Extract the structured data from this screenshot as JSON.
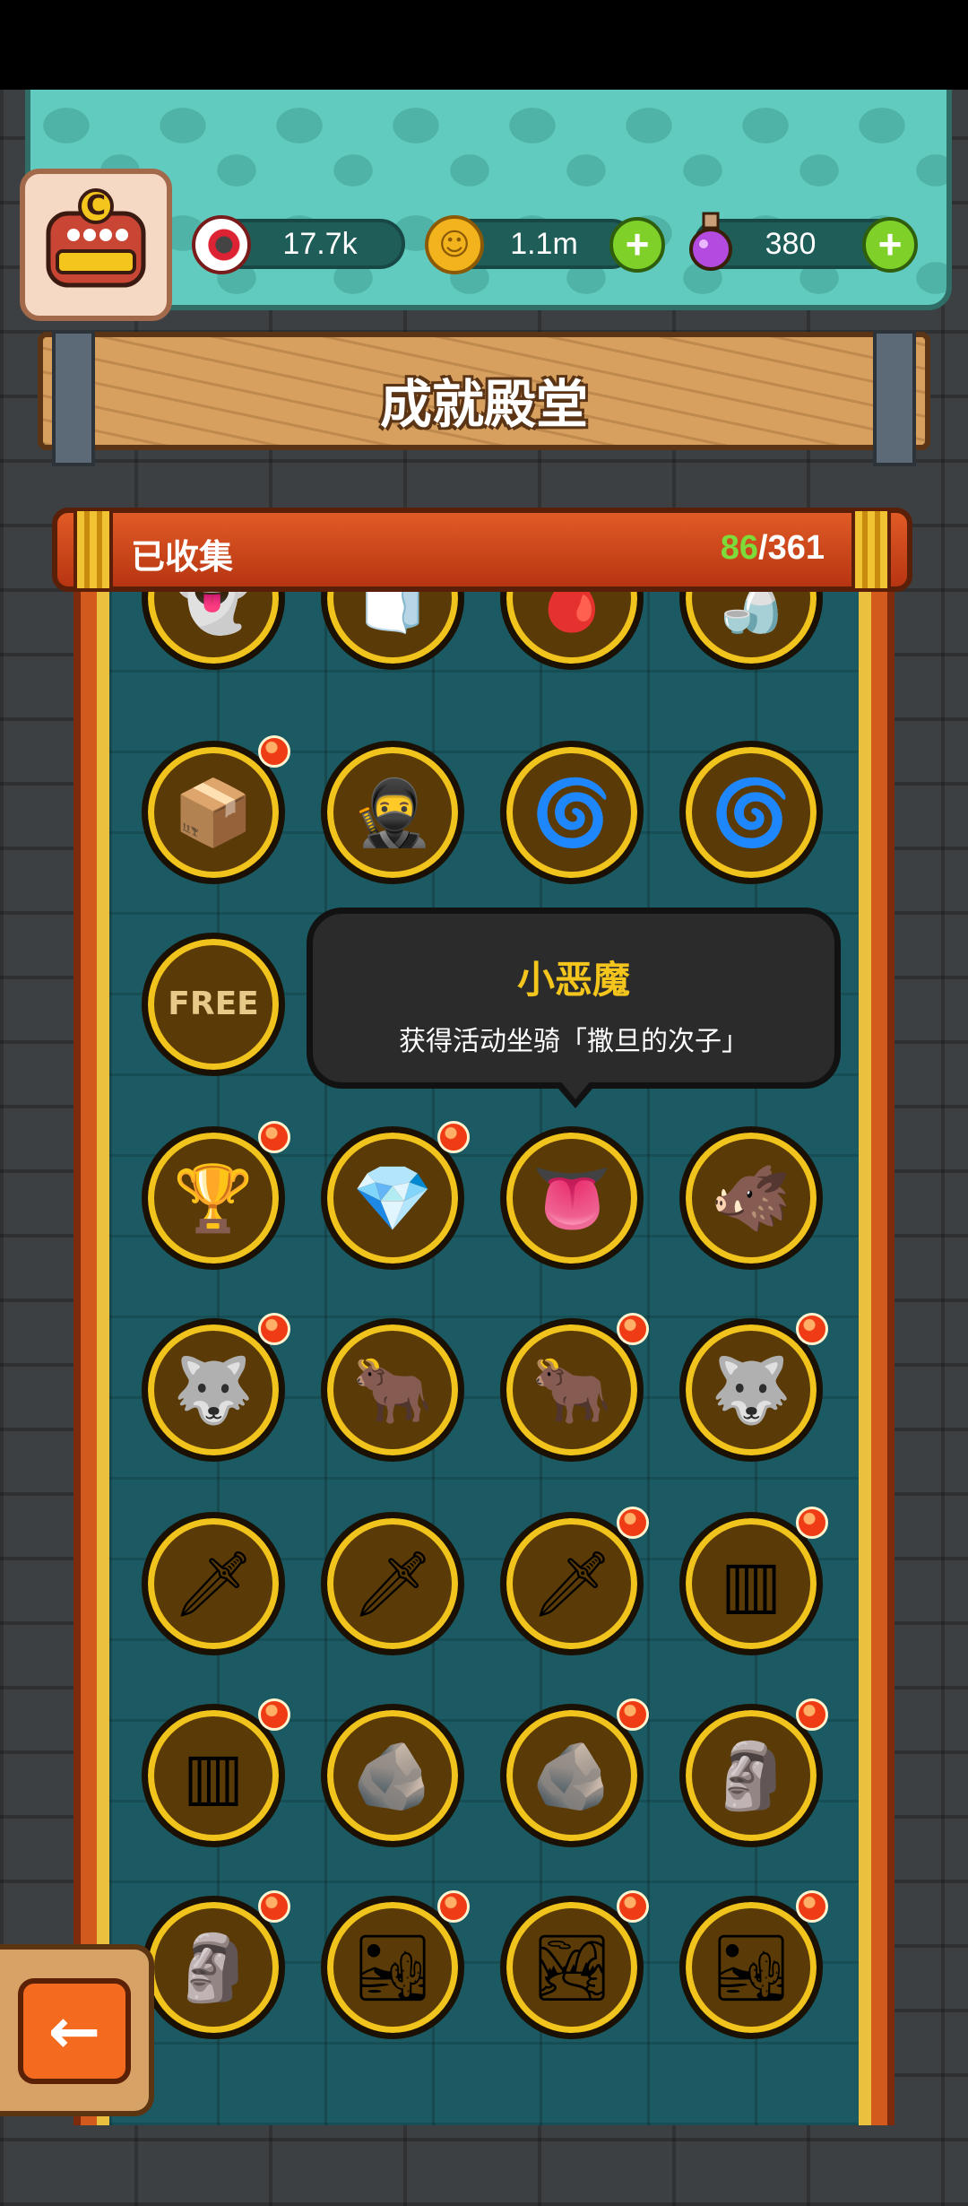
{
  "resources": {
    "eyes": {
      "value": "17.7k",
      "icon": "eyeball-icon"
    },
    "coins": {
      "value": "1.1m",
      "icon": "coin-icon"
    },
    "potions": {
      "value": "380",
      "icon": "potion-icon"
    },
    "avatar_letter": "C"
  },
  "header": {
    "title": "成就殿堂"
  },
  "collection": {
    "label": "已收集",
    "collected": "86",
    "total": "/361"
  },
  "tooltip": {
    "title": "小恶魔",
    "description": "获得活动坐骑「撒旦的次子」"
  },
  "back_button": {
    "icon": "arrow-left-icon",
    "glyph": "←"
  },
  "achievements": [
    {
      "name": "ghost-flower",
      "glyph": "👻",
      "new": false
    },
    {
      "name": "toilet-paper",
      "glyph": "🧻",
      "new": false
    },
    {
      "name": "blood-drop",
      "glyph": "🩸",
      "new": false
    },
    {
      "name": "sauce-bottle",
      "glyph": "🍶",
      "new": false
    },
    {
      "name": "blood-crate",
      "glyph": "📦",
      "new": true
    },
    {
      "name": "ninja",
      "glyph": "🥷",
      "new": false
    },
    {
      "name": "gold-oven",
      "glyph": "🌀",
      "new": false
    },
    {
      "name": "silver-oven",
      "glyph": "🌀",
      "new": false
    },
    {
      "name": "free-stand",
      "glyph": "FREE",
      "new": false
    },
    {
      "name": "silver-trophy",
      "glyph": "🏆",
      "new": true
    },
    {
      "name": "red-crystals",
      "glyph": "💎",
      "new": true
    },
    {
      "name": "little-demon",
      "glyph": "👅",
      "new": false
    },
    {
      "name": "bronze-boar",
      "glyph": "🐗",
      "new": false
    },
    {
      "name": "gold-beast",
      "glyph": "🐺",
      "new": true
    },
    {
      "name": "bronze-horned",
      "glyph": "🐂",
      "new": false
    },
    {
      "name": "gold-horned",
      "glyph": "🐂",
      "new": true
    },
    {
      "name": "silver-beast",
      "glyph": "🐺",
      "new": true
    },
    {
      "name": "bronze-sword",
      "glyph": "🗡",
      "new": false
    },
    {
      "name": "gold-sword",
      "glyph": "🗡",
      "new": false
    },
    {
      "name": "silver-sword",
      "glyph": "🗡",
      "new": true
    },
    {
      "name": "bronze-cage",
      "glyph": "▥",
      "new": true
    },
    {
      "name": "gold-cage",
      "glyph": "▥",
      "new": true
    },
    {
      "name": "bronze-pile",
      "glyph": "🪨",
      "new": false
    },
    {
      "name": "gold-pile",
      "glyph": "🪨",
      "new": true
    },
    {
      "name": "bronze-totem",
      "glyph": "🗿",
      "new": true
    },
    {
      "name": "gold-totem",
      "glyph": "🗿",
      "new": true
    },
    {
      "name": "bronze-landscape",
      "glyph": "🏜",
      "new": true
    },
    {
      "name": "silver-landscape",
      "glyph": "🏞",
      "new": true
    },
    {
      "name": "gold-landscape",
      "glyph": "🏜",
      "new": true
    }
  ],
  "colors": {
    "accent_green": "#7ddb3a",
    "tooltip_title": "#f3c51d",
    "badge": "#ef3c14"
  }
}
